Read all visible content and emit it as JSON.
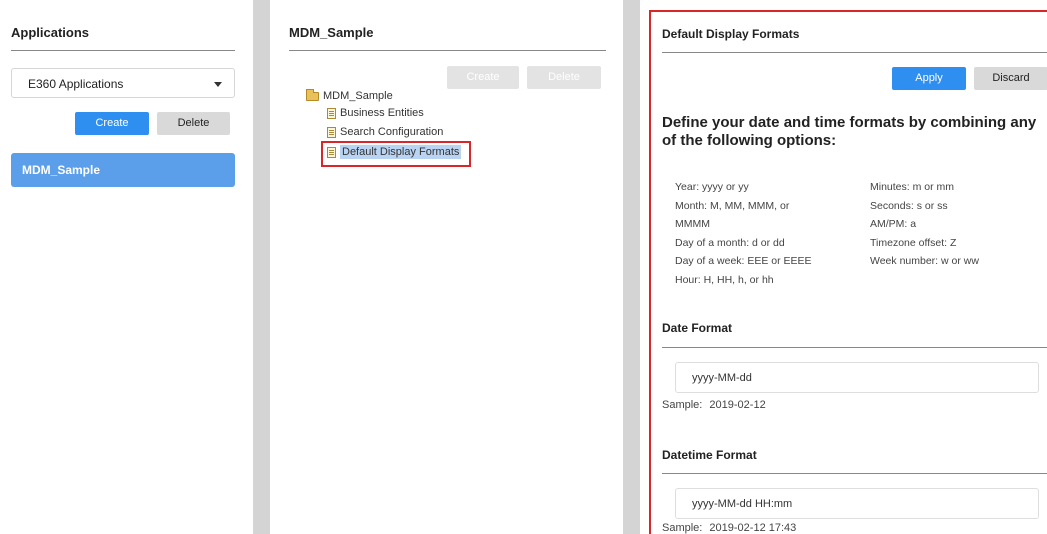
{
  "left": {
    "title": "Applications",
    "select_value": "E360 Applications",
    "create_label": "Create",
    "delete_label": "Delete",
    "items": [
      {
        "label": "MDM_Sample"
      }
    ]
  },
  "middle": {
    "title": "MDM_Sample",
    "create_label": "Create",
    "delete_label": "Delete",
    "tree": {
      "root": "MDM_Sample",
      "children": [
        {
          "label": "Business Entities"
        },
        {
          "label": "Search Configuration"
        },
        {
          "label": "Default Display Formats"
        }
      ]
    }
  },
  "right": {
    "title": "Default Display Formats",
    "apply_label": "Apply",
    "discard_label": "Discard",
    "heading": "Define your date and time formats by combining any of the following options:",
    "options_col1": [
      "Year: yyyy or yy",
      "Month: M, MM, MMM, or",
      "MMMM",
      "Day of a month: d or dd",
      "Day of a week: EEE or EEEE",
      "Hour: H, HH, h, or hh"
    ],
    "options_col2": [
      "Minutes: m or mm",
      "Seconds: s or ss",
      "AM/PM: a",
      "Timezone offset: Z",
      "Week number: w or ww"
    ],
    "date_format": {
      "title": "Date Format",
      "value": "yyyy-MM-dd",
      "sample_label": "Sample:",
      "sample_value": "2019-02-12"
    },
    "datetime_format": {
      "title": "Datetime Format",
      "value": "yyyy-MM-dd HH:mm",
      "sample_label": "Sample:",
      "sample_value": "2019-02-12 17:43"
    }
  },
  "colors": {
    "primary": "#2f8ff0",
    "selected_item": "#5b9ee9",
    "highlight": "#d9262b"
  }
}
